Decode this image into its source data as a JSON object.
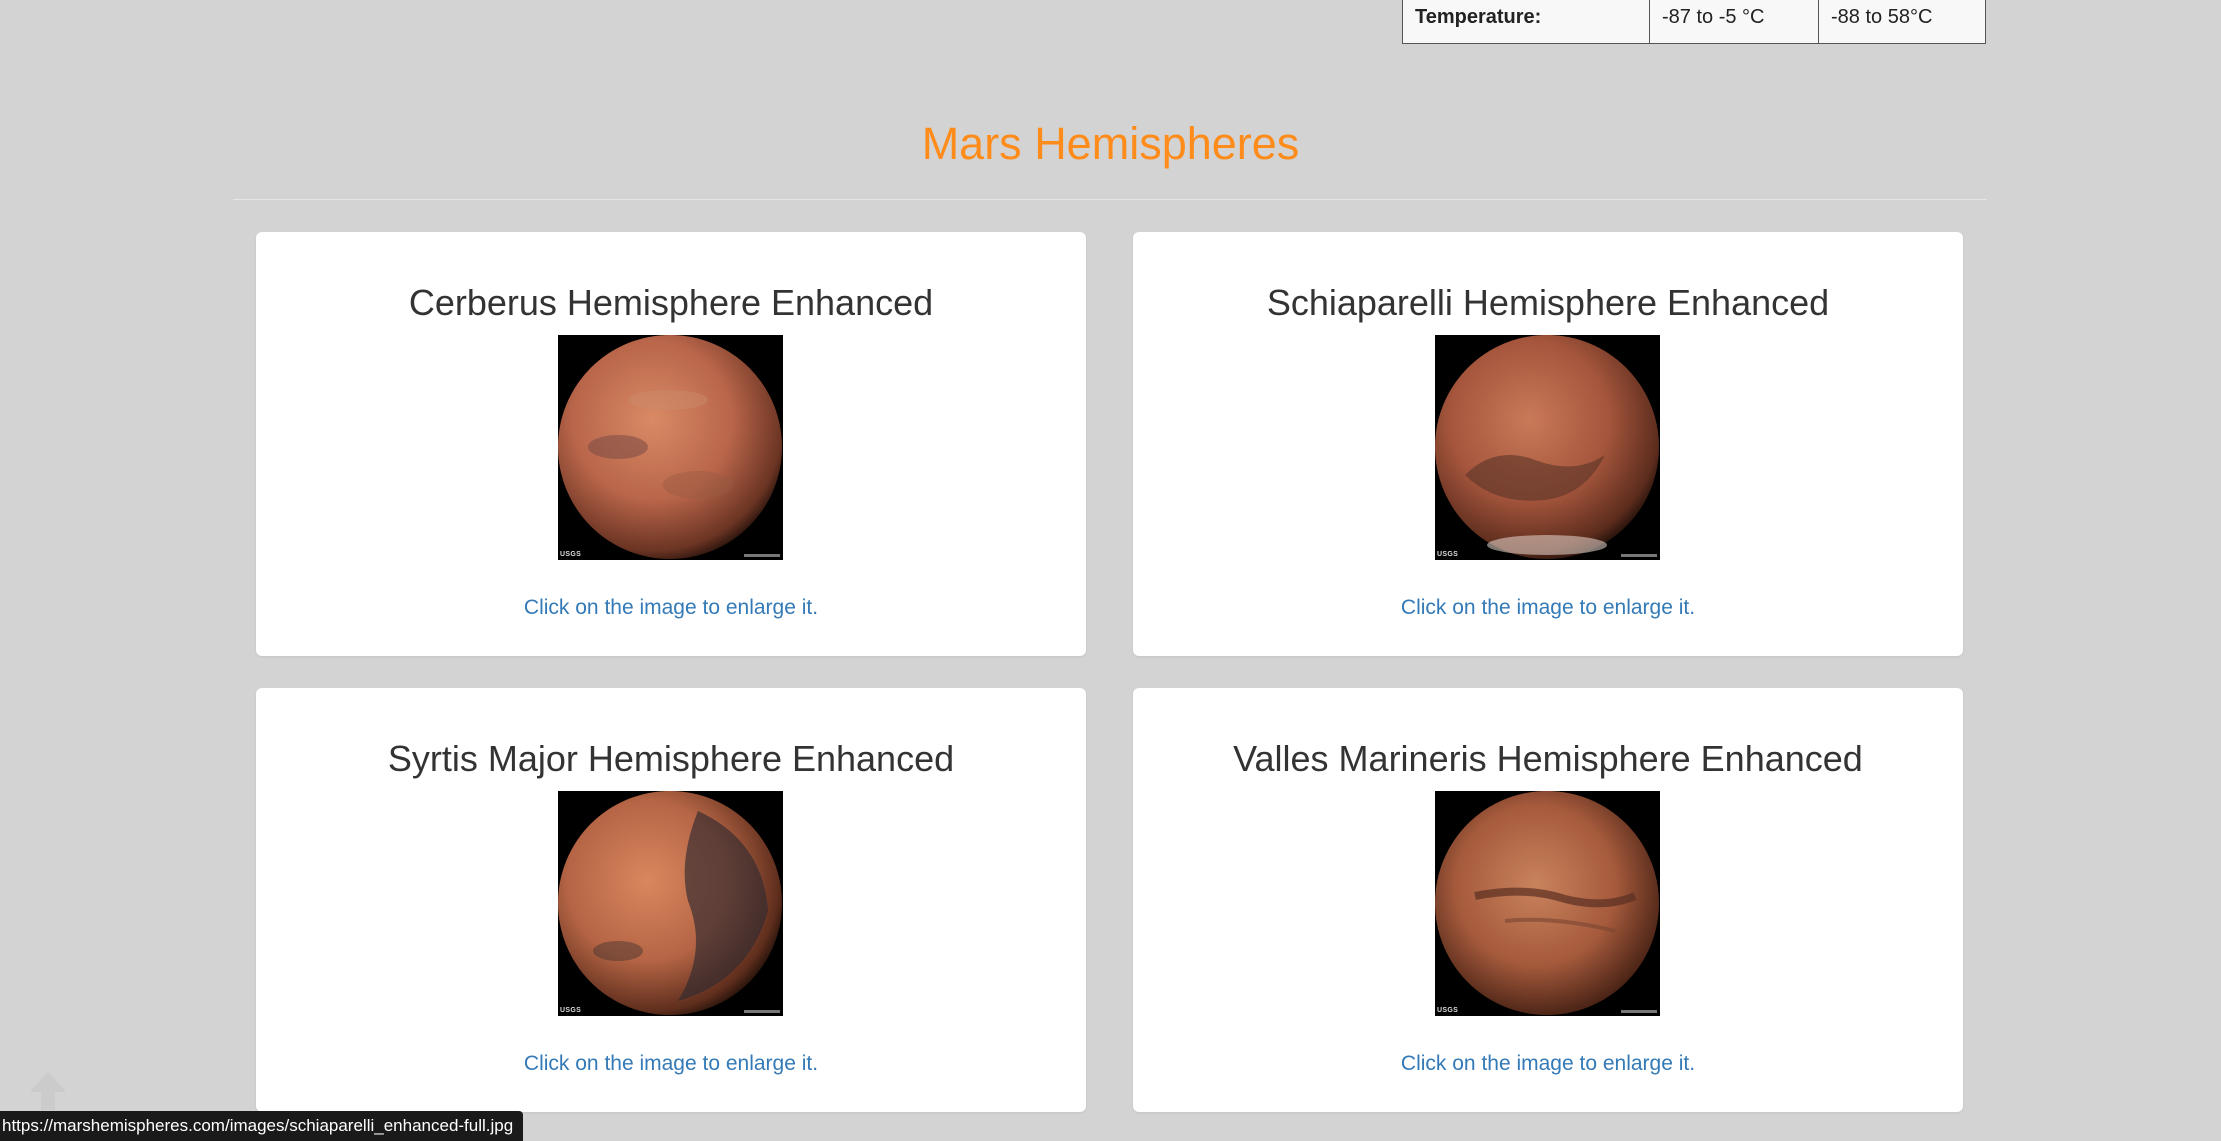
{
  "facts": {
    "row_label": "Temperature:",
    "value_1": "-87 to -5 °C",
    "value_2": "-88 to 58°C"
  },
  "section": {
    "title": "Mars Hemispheres"
  },
  "hemispheres": [
    {
      "title": "Cerberus Hemisphere Enhanced",
      "caption": "Click on the image to enlarge it.",
      "badge": "USGS"
    },
    {
      "title": "Schiaparelli Hemisphere Enhanced",
      "caption": "Click on the image to enlarge it.",
      "badge": "USGS"
    },
    {
      "title": "Syrtis Major Hemisphere Enhanced",
      "caption": "Click on the image to enlarge it.",
      "badge": "USGS"
    },
    {
      "title": "Valles Marineris Hemisphere Enhanced",
      "caption": "Click on the image to enlarge it.",
      "badge": "USGS"
    }
  ],
  "status_bar": {
    "url": "https://marshemispheres.com/images/schiaparelli_enhanced-full.jpg"
  },
  "colors": {
    "background": "#d3d3d3",
    "title_accent": "#ff8c1a",
    "link": "#337ab7"
  },
  "icons": {
    "scroll_top": "arrow-up-icon"
  }
}
